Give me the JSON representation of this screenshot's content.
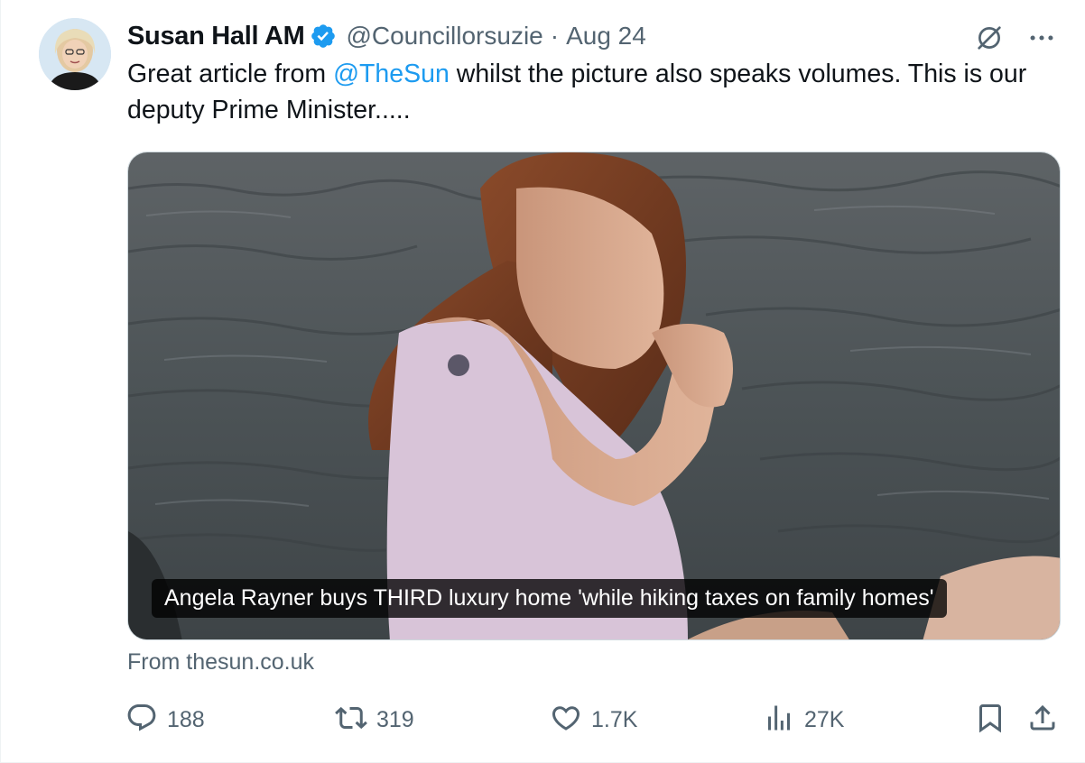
{
  "author": {
    "display_name": "Susan Hall AM",
    "handle": "@Councillorsuzie",
    "separator": "·",
    "date": "Aug 24",
    "verified": true
  },
  "tweet": {
    "text_before": "Great article from ",
    "mention": "@TheSun",
    "text_after": " whilst the picture also speaks volumes. This is our deputy Prime Minister....."
  },
  "card": {
    "caption": "Angela Rayner buys THIRD luxury home 'while hiking taxes on family homes'",
    "source": "From thesun.co.uk"
  },
  "actions": {
    "replies": "188",
    "reposts": "319",
    "likes": "1.7K",
    "views": "27K"
  },
  "icons": {
    "verified": "verified-badge-icon",
    "grok": "grok-icon",
    "more": "more-icon",
    "reply": "reply-icon",
    "repost": "repost-icon",
    "like": "like-icon",
    "views": "views-icon",
    "bookmark": "bookmark-icon",
    "share": "share-icon"
  },
  "colors": {
    "accent": "#1d9bf0",
    "secondary_text": "#536471",
    "primary_text": "#0f1419"
  }
}
